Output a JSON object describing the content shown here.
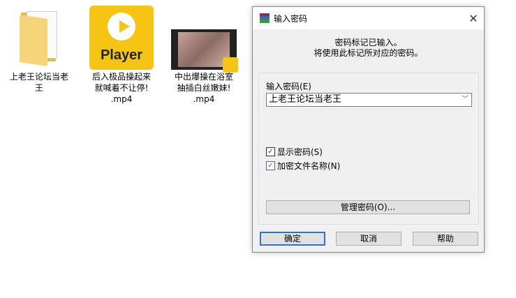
{
  "desktop": [
    {
      "label": "上老王论坛当老\n王",
      "icon": "folder-icon"
    },
    {
      "label": "后入极品操起来\n就喊着不让停!\n.mp4",
      "icon": "player-icon",
      "icon_text": "Player"
    },
    {
      "label": "中出爆操在浴室\n抽插白丝嫩妹!\n.mp4",
      "icon": "video-thumbnail-icon"
    }
  ],
  "dialog": {
    "title": "输入密码",
    "message_line1": "密码标记已输入。",
    "message_line2": "将使用此标记所对应的密码。",
    "password_label": "输入密码(E)",
    "password_value": "上老王论坛当老王",
    "show_password": {
      "label": "显示密码(S)",
      "checked": true
    },
    "encrypt_filenames": {
      "label": "加密文件名称(N)",
      "checked": true
    },
    "manage_button": "管理密码(O)...",
    "ok_button": "确定",
    "cancel_button": "取消",
    "help_button": "帮助"
  }
}
